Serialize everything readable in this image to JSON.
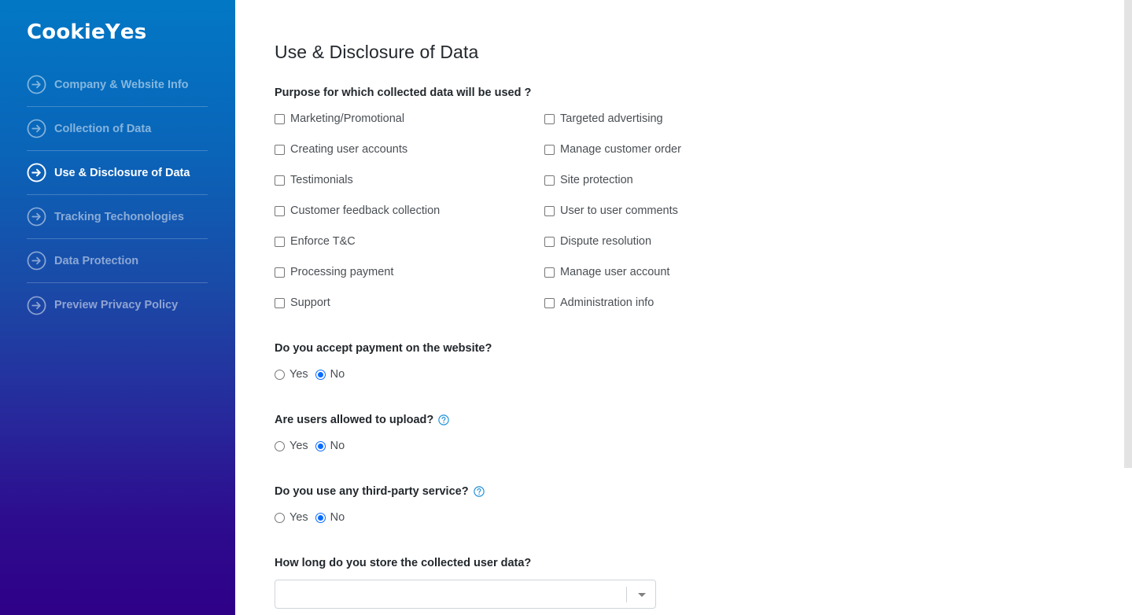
{
  "brand": {
    "logo_text_before": "Cookie",
    "logo_text_y": "Y",
    "logo_text_after": "es"
  },
  "sidebar": {
    "items": [
      {
        "label": "Company & Website Info",
        "icon": "arrow-circle-right-icon",
        "active": false
      },
      {
        "label": "Collection of Data",
        "icon": "arrow-circle-right-icon",
        "active": false
      },
      {
        "label": "Use & Disclosure of Data",
        "icon": "arrow-circle-right-icon",
        "active": true
      },
      {
        "label": "Tracking Techonologies",
        "icon": "arrow-circle-right-icon",
        "active": false
      },
      {
        "label": "Data Protection",
        "icon": "arrow-circle-right-icon",
        "active": false
      },
      {
        "label": "Preview Privacy Policy",
        "icon": "arrow-circle-right-icon",
        "active": false
      }
    ]
  },
  "main": {
    "title": "Use & Disclosure of Data",
    "purpose": {
      "question": "Purpose for which collected data will be used ?",
      "options_left": [
        {
          "label": "Marketing/Promotional",
          "checked": false
        },
        {
          "label": "Creating user accounts",
          "checked": false
        },
        {
          "label": "Testimonials",
          "checked": false
        },
        {
          "label": "Customer feedback collection",
          "checked": false
        },
        {
          "label": "Enforce T&C",
          "checked": false
        },
        {
          "label": "Processing payment",
          "checked": false
        },
        {
          "label": "Support",
          "checked": false
        }
      ],
      "options_right": [
        {
          "label": "Targeted advertising",
          "checked": false
        },
        {
          "label": "Manage customer order",
          "checked": false
        },
        {
          "label": "Site protection",
          "checked": false
        },
        {
          "label": "User to user comments",
          "checked": false
        },
        {
          "label": "Dispute resolution",
          "checked": false
        },
        {
          "label": "Manage user account",
          "checked": false
        },
        {
          "label": "Administration info",
          "checked": false
        }
      ]
    },
    "payment": {
      "question": "Do you accept payment on the website?",
      "options": [
        "Yes",
        "No"
      ],
      "selected": "No",
      "has_help": false
    },
    "upload": {
      "question": "Are users allowed to upload?",
      "options": [
        "Yes",
        "No"
      ],
      "selected": "No",
      "has_help": true
    },
    "third_party": {
      "question": "Do you use any third-party service?",
      "options": [
        "Yes",
        "No"
      ],
      "selected": "No",
      "has_help": true
    },
    "retention": {
      "question": "How long do you store the collected user data?",
      "value": ""
    }
  },
  "colors": {
    "accent": "#0a6cff",
    "help_icon": "#1a8fd8",
    "sidebar_top": "#0278c5",
    "sidebar_bottom": "#2e0088",
    "scrollbar": "#e3e3e3"
  }
}
